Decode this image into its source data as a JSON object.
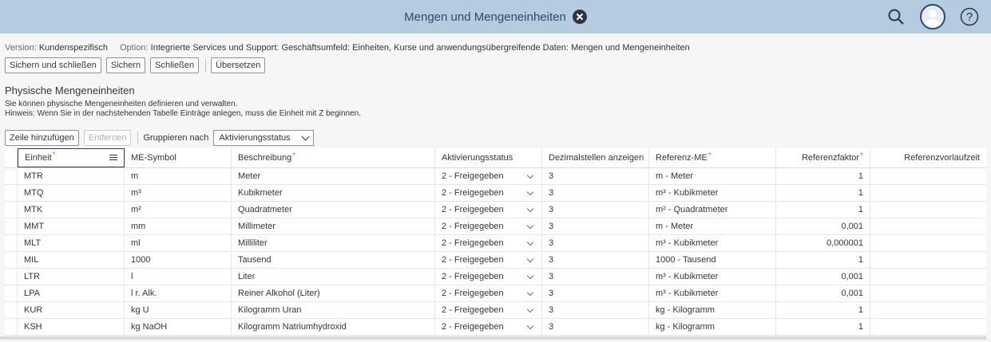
{
  "shell": {
    "title": "Mengen und Mengeneinheiten",
    "icons": [
      "search-icon",
      "user-avatar-icon",
      "help-icon",
      "close-icon"
    ]
  },
  "version": {
    "label": "Version:",
    "value": "Kundenspezifisch",
    "option_label": "Option:",
    "option_value": "Integrierte Services und Support: Geschäftsumfeld: Einheiten, Kurse und anwendungsübergreifende Daten: Mengen und Mengeneinheiten"
  },
  "toolbar": {
    "save_close": "Sichern und schließen",
    "save": "Sichern",
    "close": "Schließen",
    "translate": "Übersetzen"
  },
  "section": {
    "title": "Physische Mengeneinheiten",
    "desc1": "Sie können physische Mengeneinheiten definieren und verwalten.",
    "desc2": "Hinweis: Wenn Sie in der nachstehenden Tabelle Einträge anlegen, muss die Einheit mit Z beginnen."
  },
  "table_toolbar": {
    "add_row": "Zeile hinzufügen",
    "remove": "Entfernen",
    "group_by_label": "Gruppieren nach",
    "group_by_value": "Aktivierungsstatus"
  },
  "columns": {
    "unit": "Einheit",
    "symbol": "ME-Symbol",
    "description": "Beschreibung",
    "status": "Aktivierungsstatus",
    "decimals": "Dezimalstellen anzeigen",
    "ref_unit": "Referenz-ME",
    "ref_factor": "Referenzfaktor",
    "ref_lead": "Referenzvorlaufzeit",
    "required_mark": "*"
  },
  "rows": [
    {
      "unit": "MTR",
      "symbol": "m",
      "description": "Meter",
      "status": "2 - Freigegeben",
      "decimals": "3",
      "ref_unit": "m - Meter",
      "ref_factor": "1",
      "ref_lead": ""
    },
    {
      "unit": "MTQ",
      "symbol": "m³",
      "description": "Kubikmeter",
      "status": "2 - Freigegeben",
      "decimals": "3",
      "ref_unit": "m³ - Kubikmeter",
      "ref_factor": "1",
      "ref_lead": ""
    },
    {
      "unit": "MTK",
      "symbol": "m²",
      "description": "Quadratmeter",
      "status": "2 - Freigegeben",
      "decimals": "3",
      "ref_unit": "m² - Quadratmeter",
      "ref_factor": "1",
      "ref_lead": ""
    },
    {
      "unit": "MMT",
      "symbol": "mm",
      "description": "Millimeter",
      "status": "2 - Freigegeben",
      "decimals": "3",
      "ref_unit": "m - Meter",
      "ref_factor": "0,001",
      "ref_lead": ""
    },
    {
      "unit": "MLT",
      "symbol": "ml",
      "description": "Milliliter",
      "status": "2 - Freigegeben",
      "decimals": "3",
      "ref_unit": "m³ - Kubikmeter",
      "ref_factor": "0,000001",
      "ref_lead": ""
    },
    {
      "unit": "MIL",
      "symbol": "1000",
      "description": "Tausend",
      "status": "2 - Freigegeben",
      "decimals": "3",
      "ref_unit": "1000 - Tausend",
      "ref_factor": "1",
      "ref_lead": ""
    },
    {
      "unit": "LTR",
      "symbol": "l",
      "description": "Liter",
      "status": "2 - Freigegeben",
      "decimals": "3",
      "ref_unit": "m³ - Kubikmeter",
      "ref_factor": "0,001",
      "ref_lead": ""
    },
    {
      "unit": "LPA",
      "symbol": "l r. Alk.",
      "description": "Reiner Alkohol (Liter)",
      "status": "2 - Freigegeben",
      "decimals": "3",
      "ref_unit": "m³ - Kubikmeter",
      "ref_factor": "0,001",
      "ref_lead": ""
    },
    {
      "unit": "KUR",
      "symbol": "kg U",
      "description": "Kilogramm Uran",
      "status": "2 - Freigegeben",
      "decimals": "3",
      "ref_unit": "kg - Kilogramm",
      "ref_factor": "1",
      "ref_lead": ""
    },
    {
      "unit": "KSH",
      "symbol": "kg NaOH",
      "description": "Kilogramm Natriumhydroxid",
      "status": "2 - Freigegeben",
      "decimals": "3",
      "ref_unit": "kg - Kilogramm",
      "ref_factor": "1",
      "ref_lead": ""
    }
  ],
  "colors": {
    "shell_bg": "#b5cbe0",
    "page_bg": "#f5f6f7",
    "required": "#e9730c"
  }
}
